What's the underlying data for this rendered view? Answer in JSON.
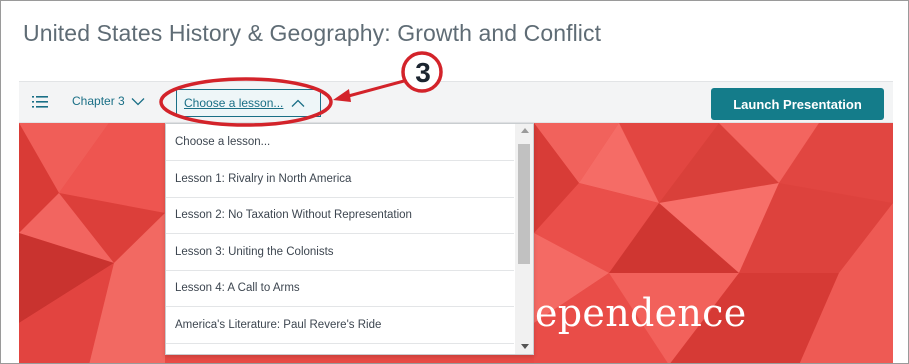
{
  "page": {
    "title": "United States History & Geography: Growth and Conflict"
  },
  "toolbar": {
    "chapter_label": "Chapter 3",
    "lesson_select_value": "Choose a lesson...",
    "launch_label": "Launch Presentation"
  },
  "dropdown": {
    "options": [
      "Choose a lesson...",
      "Lesson 1: Rivalry in North America",
      "Lesson 2: No Taxation Without Representation",
      "Lesson 3: Uniting the Colonists",
      "Lesson 4: A Call to Arms",
      "America's Literature: Paul Revere's Ride"
    ]
  },
  "banner": {
    "visible_text": "ependence"
  },
  "annotation": {
    "step_number": "3",
    "color": "#d3232a"
  },
  "colors": {
    "accent": "#147c8a",
    "link": "#1a6f86",
    "banner": "#e84a45"
  }
}
